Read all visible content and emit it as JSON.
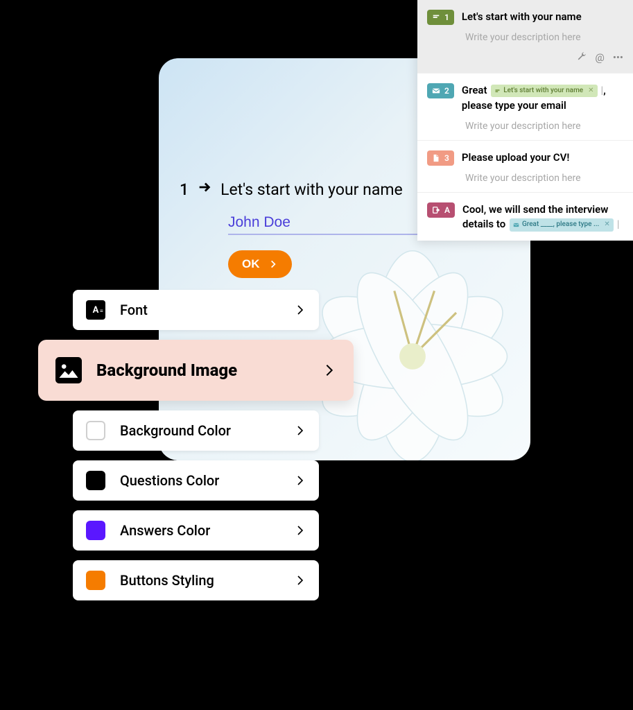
{
  "preview": {
    "question_number": "1",
    "question_text": "Let's start with your name",
    "answer_value": "John Doe",
    "ok_label": "OK"
  },
  "settings": {
    "items": [
      {
        "label": "Font",
        "icon": "font-icon",
        "swatch": null
      },
      {
        "label": "Background Image",
        "icon": "image-icon",
        "swatch": null,
        "active": true
      },
      {
        "label": "Background Color",
        "icon": "swatch",
        "swatch": "#ffffff",
        "border": "#cfcfcf"
      },
      {
        "label": "Questions Color",
        "icon": "swatch",
        "swatch": "#000000"
      },
      {
        "label": "Answers Color",
        "icon": "swatch",
        "swatch": "#5a17ff"
      },
      {
        "label": "Buttons Styling",
        "icon": "swatch",
        "swatch": "#f57c00"
      }
    ]
  },
  "panel": {
    "items": [
      {
        "badge_num": "1",
        "badge_color": "#6f8f3b",
        "title_text": "Let's start with your name",
        "desc": "Write your description here",
        "selected": true,
        "tools": true,
        "chip": null
      },
      {
        "badge_num": "2",
        "badge_color": "#4fa7b3",
        "title_pre": "Great ",
        "title_post": ", please type your email",
        "chip": {
          "text": "Let's start with your name",
          "bg": "#d1e7b8",
          "fg": "#5f7d33",
          "icon_bg": "#6f8f3b"
        },
        "desc": "Write your description here"
      },
      {
        "badge_num": "3",
        "badge_color": "#f19b84",
        "title_text": "Please upload your CV!",
        "desc": "Write your description here",
        "chip": null
      },
      {
        "badge_num": "A",
        "badge_color": "#b74f71",
        "title_pre": "Cool, we will send the interview details to ",
        "title_post": "",
        "chip": {
          "text": "Great ____, please type ...",
          "bg": "#bfe2e7",
          "fg": "#2e7a86",
          "icon_bg": "#4fa7b3"
        }
      }
    ]
  }
}
